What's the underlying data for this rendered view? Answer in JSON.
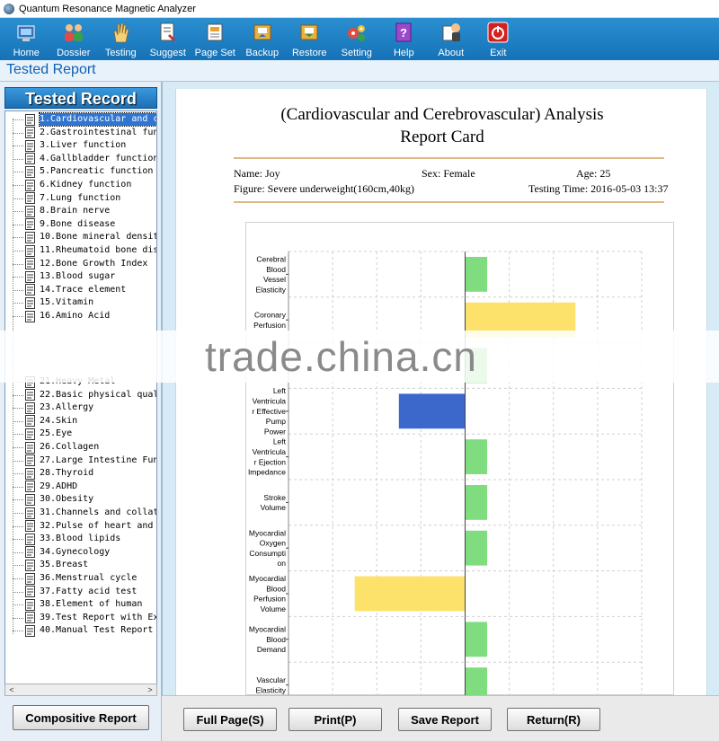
{
  "window": {
    "title": "Quantum Resonance Magnetic Analyzer"
  },
  "toolbar": {
    "items": [
      {
        "label": "Home",
        "icon": "home-icon"
      },
      {
        "label": "Dossier",
        "icon": "people-icon"
      },
      {
        "label": "Testing",
        "icon": "hand-icon"
      },
      {
        "label": "Suggest",
        "icon": "document-icon"
      },
      {
        "label": "Page Set",
        "icon": "page-setup-icon"
      },
      {
        "label": "Backup",
        "icon": "backup-icon"
      },
      {
        "label": "Restore",
        "icon": "restore-icon"
      },
      {
        "label": "Setting",
        "icon": "gears-icon"
      },
      {
        "label": "Help",
        "icon": "help-book-icon"
      },
      {
        "label": "About",
        "icon": "about-icon"
      },
      {
        "label": "Exit",
        "icon": "power-icon"
      }
    ]
  },
  "page_header": "Tested Report",
  "sidebar": {
    "title": "Tested Record",
    "items": [
      "1.Cardiovascular and ce",
      "2.Gastrointestinal func",
      "3.Liver function",
      "4.Gallbladder function",
      "5.Pancreatic function",
      "6.Kidney function",
      "7.Lung function",
      "8.Brain nerve",
      "9.Bone disease",
      "10.Bone mineral density",
      "11.Rheumatoid bone dise",
      "12.Bone Growth Index",
      "13.Blood sugar",
      "14.Trace element",
      "15.Vitamin",
      "16.Amino Acid",
      "",
      "",
      "",
      "",
      "21.Heavy Metal",
      "22.Basic physical quali",
      "23.Allergy",
      "24.Skin",
      "25.Eye",
      "26.Collagen",
      "27.Large Intestine Func",
      "28.Thyroid",
      "29.ADHD",
      "30.Obesity",
      "31.Channels and collate",
      "32.Pulse of heart and b",
      "33.Blood lipids",
      "34.Gynecology",
      "35.Breast",
      "36.Menstrual cycle",
      "37.Fatty acid test",
      "38.Element of human",
      "39.Test Report with Exp",
      "40.Manual Test Report"
    ],
    "selected_index": 0,
    "composite_button": "Compositive Report"
  },
  "report": {
    "title_line1": "(Cardiovascular and Cerebrovascular) Analysis",
    "title_line2": "Report Card",
    "name": "Name: Joy",
    "sex": "Sex: Female",
    "age": "Age: 25",
    "figure": "Figure: Severe underweight(160cm,40kg)",
    "testing_time": "Testing Time: 2016-05-03 13:37"
  },
  "chart_data": {
    "type": "bar",
    "orientation": "horizontal",
    "grid": true,
    "legend": "none",
    "categories": [
      [
        "Cerebral",
        "Blood",
        "Vessel",
        "Elasticity"
      ],
      [
        "Coronary",
        "Perfusion"
      ],
      [],
      [
        "Left",
        "Ventricula",
        "r Effective",
        "Pump",
        "Power"
      ],
      [
        "Left",
        "Ventricula",
        "r Ejection",
        "Impedance"
      ],
      [
        "Stroke",
        "Volume"
      ],
      [
        "Myocardial",
        "Oxygen",
        "Consumpti",
        "on"
      ],
      [
        "Myocardial",
        "Blood",
        "Perfusion",
        "Volume"
      ],
      [
        "Myocardial",
        "Blood",
        "Demand"
      ],
      [
        "Vascular",
        "Elasticity"
      ]
    ],
    "values": [
      1,
      5,
      1,
      -3,
      1,
      1,
      1,
      -5,
      1,
      1
    ],
    "bar_colors": [
      "#7fdc7f",
      "#fce26a",
      "#7fdc7f",
      "#3c68cc",
      "#7fdc7f",
      "#7fdc7f",
      "#7fdc7f",
      "#fce26a",
      "#7fdc7f",
      "#7fdc7f"
    ],
    "xlim": [
      -8,
      8
    ]
  },
  "watermark": "trade.china.cn",
  "buttons": {
    "full_page": "Full Page(S)",
    "print": "Print(P)",
    "save_report": "Save Report",
    "return": "Return(R)"
  }
}
